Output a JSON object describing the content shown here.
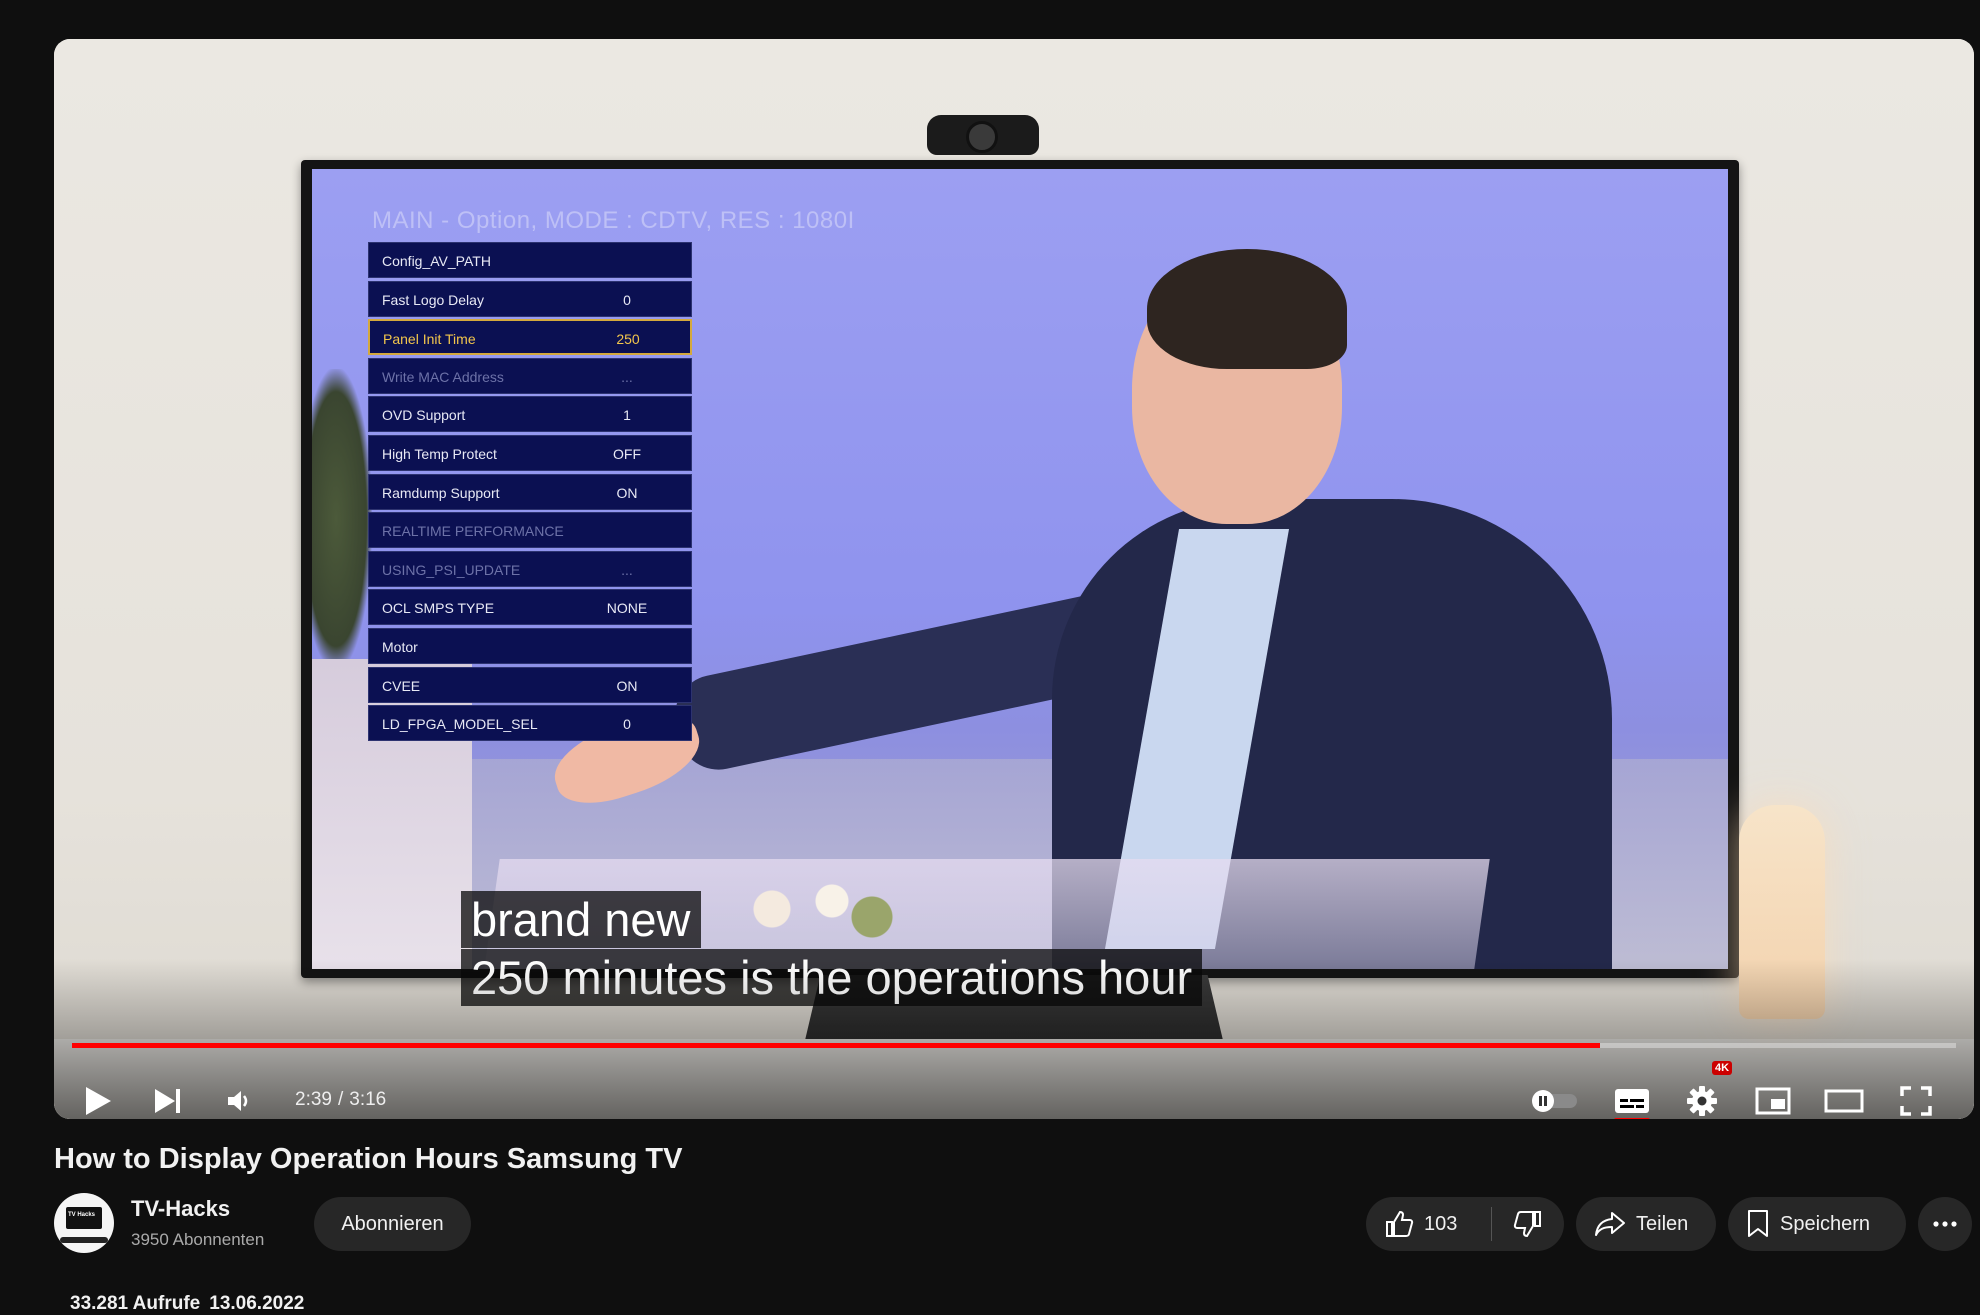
{
  "player": {
    "service_menu": {
      "watermark": "MAIN - Option, MODE : CDTV, RES : 1080I",
      "rows": [
        {
          "label": "Config_AV_PATH",
          "value": ""
        },
        {
          "label": "Fast Logo Delay",
          "value": "0"
        },
        {
          "label": "Panel Init Time",
          "value": "250"
        },
        {
          "label": "Write MAC Address",
          "value": "..."
        },
        {
          "label": "OVD Support",
          "value": "1"
        },
        {
          "label": "High Temp Protect",
          "value": "OFF"
        },
        {
          "label": "Ramdump Support",
          "value": "ON"
        },
        {
          "label": "REALTIME PERFORMANCE",
          "value": ""
        },
        {
          "label": "USING_PSI_UPDATE",
          "value": "..."
        },
        {
          "label": "OCL SMPS TYPE",
          "value": "NONE"
        },
        {
          "label": "Motor",
          "value": ""
        },
        {
          "label": "CVEE",
          "value": "ON"
        },
        {
          "label": "LD_FPGA_MODEL_SEL",
          "value": "0"
        }
      ],
      "selected_row": "Panel Init Time"
    },
    "captions": {
      "line1": "brand new",
      "line2": "250 minutes is the operations hour"
    },
    "controls": {
      "current_time": "2:39",
      "separator": "/",
      "duration": "3:16",
      "progress_fraction": 0.811,
      "quality_badge": "4K",
      "icons": [
        "play-icon",
        "next-icon",
        "volume-icon",
        "autoplay-toggle-icon",
        "subtitles-icon",
        "settings-icon",
        "miniplayer-icon",
        "theater-mode-icon",
        "fullscreen-icon"
      ]
    }
  },
  "video": {
    "title": "How to Display Operation Hours Samsung TV",
    "views": "33.281 Aufrufe",
    "date": "13.06.2022"
  },
  "channel": {
    "name": "TV-Hacks",
    "subscribers": "3950 Abonnenten",
    "avatar_text": "TV Hacks"
  },
  "actions": {
    "subscribe": "Abonnieren",
    "like_count": "103",
    "share": "Teilen",
    "save": "Speichern"
  },
  "colors": {
    "background": "#0f0f0f",
    "progress": "#ff0000",
    "pill": "#272727",
    "menu_bg": "#0b1052",
    "menu_selected": "#f3c64c"
  }
}
